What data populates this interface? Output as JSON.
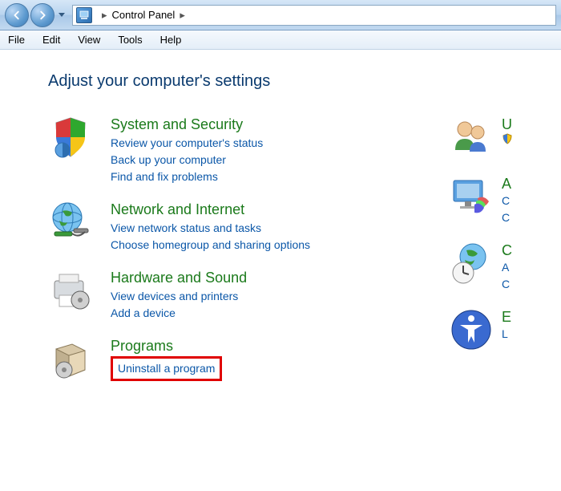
{
  "nav": {
    "breadcrumb_location": "Control Panel"
  },
  "menu": {
    "items": [
      "File",
      "Edit",
      "View",
      "Tools",
      "Help"
    ]
  },
  "page": {
    "title": "Adjust your computer's settings"
  },
  "categories_left": [
    {
      "title": "System and Security",
      "links": [
        "Review your computer's status",
        "Back up your computer",
        "Find and fix problems"
      ]
    },
    {
      "title": "Network and Internet",
      "links": [
        "View network status and tasks",
        "Choose homegroup and sharing options"
      ]
    },
    {
      "title": "Hardware and Sound",
      "links": [
        "View devices and printers",
        "Add a device"
      ]
    },
    {
      "title": "Programs",
      "links": [
        "Uninstall a program"
      ]
    }
  ],
  "categories_right_partial": [
    {
      "title_fragment": "U",
      "link_fragments": [
        ""
      ]
    },
    {
      "title_fragment": "A",
      "link_fragments": [
        "C",
        "C"
      ]
    },
    {
      "title_fragment": "C",
      "link_fragments": [
        "A",
        "C"
      ]
    },
    {
      "title_fragment": "E",
      "link_fragments": [
        "L"
      ]
    }
  ]
}
